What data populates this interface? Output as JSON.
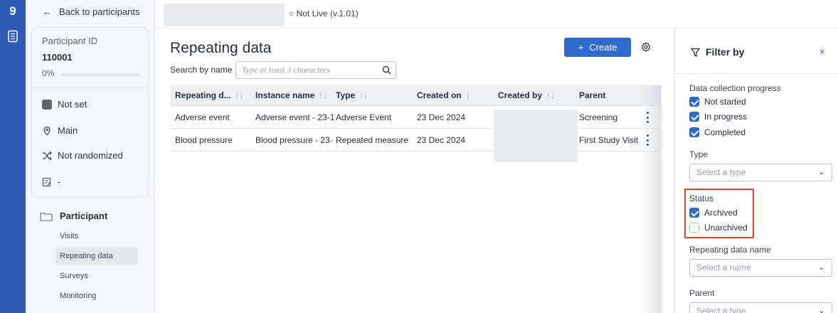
{
  "app": {
    "logo_glyph": "9",
    "accent": "#2f5bb7"
  },
  "sidebar": {
    "back_label": "Back to participants",
    "participant_label": "Participant ID",
    "participant_id": "110001",
    "progress_text": "0%",
    "progress_value": 0,
    "items": [
      {
        "icon": "square-icon",
        "label": "Not set"
      },
      {
        "icon": "location-icon",
        "label": "Main"
      },
      {
        "icon": "shuffle-icon",
        "label": "Not randomized"
      },
      {
        "icon": "edit-note-icon",
        "label": "-"
      }
    ],
    "section_title": "Participant",
    "nav": [
      {
        "label": "Visits",
        "active": false
      },
      {
        "label": "Repeating data",
        "active": true
      },
      {
        "label": "Surveys",
        "active": false
      },
      {
        "label": "Monitoring",
        "active": false
      }
    ]
  },
  "topbar": {
    "status": "○  Not Live (v.1.01)"
  },
  "main": {
    "title": "Repeating data",
    "create_label": "Create",
    "search_label": "Search by name",
    "search_placeholder": "Type at least 3 characters",
    "columns": [
      "Repeating d...",
      "Instance name",
      "Type",
      "Created on",
      "Created by",
      "Parent"
    ],
    "sort_glyphs": [
      "↑↓",
      "↑↓",
      "↑↓",
      "↓",
      "↑↓",
      ""
    ],
    "rows": [
      {
        "repeating": "Adverse event",
        "instance": "Adverse event - 23-1",
        "type": "Adverse Event",
        "created_on": "23 Dec 2024",
        "created_by": "",
        "parent": "Screening"
      },
      {
        "repeating": "Blood pressure",
        "instance": "Blood pressure - 23-",
        "type": "Repeated measure",
        "created_on": "23 Dec 2024",
        "created_by": "",
        "parent": "First Study Visit"
      }
    ]
  },
  "filter": {
    "title": "Filter by",
    "close": "×",
    "progress_label": "Data collection progress",
    "progress_options": [
      {
        "label": "Not started",
        "checked": true
      },
      {
        "label": "In progress",
        "checked": true
      },
      {
        "label": "Completed",
        "checked": true
      }
    ],
    "type_label": "Type",
    "type_placeholder": "Select a type",
    "status_label": "Status",
    "status_options": [
      {
        "label": "Archived",
        "checked": true
      },
      {
        "label": "Unarchived",
        "checked": false
      }
    ],
    "name_label": "Repeating data name",
    "name_placeholder": "Select a name",
    "parent_label": "Parent",
    "parent_placeholder": "Select a type"
  }
}
